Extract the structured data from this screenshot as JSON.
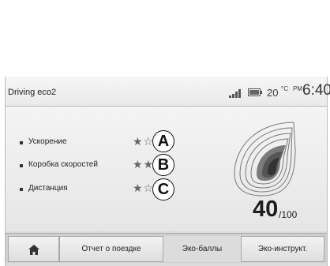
{
  "status_bar": {
    "app_title": "Driving eco2",
    "temperature": "20",
    "temperature_unit": "°C",
    "period": "PM",
    "time": "6:40"
  },
  "eco_scores": {
    "rows": [
      {
        "label": "Ускорение",
        "stars": "★☆☆☆",
        "callout": "A"
      },
      {
        "label": "Коробка скоростей",
        "stars": "★★★★",
        "callout": "B"
      },
      {
        "label": "Дистанция",
        "stars": "★☆☆☆",
        "callout": "C"
      }
    ],
    "score": "40",
    "score_max": "/100"
  },
  "tabs": {
    "home_icon": "home-icon",
    "trip_report": "Отчет о поездке",
    "eco_points": "Эко-баллы",
    "eco_instructor": "Эко-инструкт."
  },
  "colors": {
    "background": "#dcdcdc",
    "text": "#1e1e1e"
  }
}
